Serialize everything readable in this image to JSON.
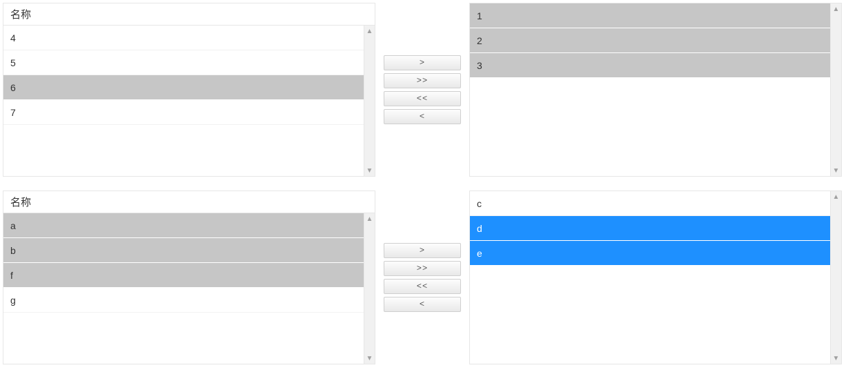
{
  "transfers": [
    {
      "left": {
        "header": "名称",
        "items": [
          {
            "label": "4",
            "state": "normal"
          },
          {
            "label": "5",
            "state": "normal"
          },
          {
            "label": "6",
            "state": "selected"
          },
          {
            "label": "7",
            "state": "normal"
          }
        ]
      },
      "right": {
        "header": null,
        "items": [
          {
            "label": "1",
            "state": "selected"
          },
          {
            "label": "2",
            "state": "selected"
          },
          {
            "label": "3",
            "state": "selected"
          }
        ]
      },
      "buttons": {
        "move_right": ">",
        "move_all_right": ">>",
        "move_all_left": "<<",
        "move_left": "<"
      }
    },
    {
      "left": {
        "header": "名称",
        "items": [
          {
            "label": "a",
            "state": "selected"
          },
          {
            "label": "b",
            "state": "selected"
          },
          {
            "label": "f",
            "state": "selected"
          },
          {
            "label": "g",
            "state": "normal"
          }
        ]
      },
      "right": {
        "header": null,
        "items": [
          {
            "label": "c",
            "state": "normal"
          },
          {
            "label": "d",
            "state": "highlight"
          },
          {
            "label": "e",
            "state": "highlight"
          }
        ]
      },
      "buttons": {
        "move_right": ">",
        "move_all_right": ">>",
        "move_all_left": "<<",
        "move_left": "<"
      }
    }
  ]
}
